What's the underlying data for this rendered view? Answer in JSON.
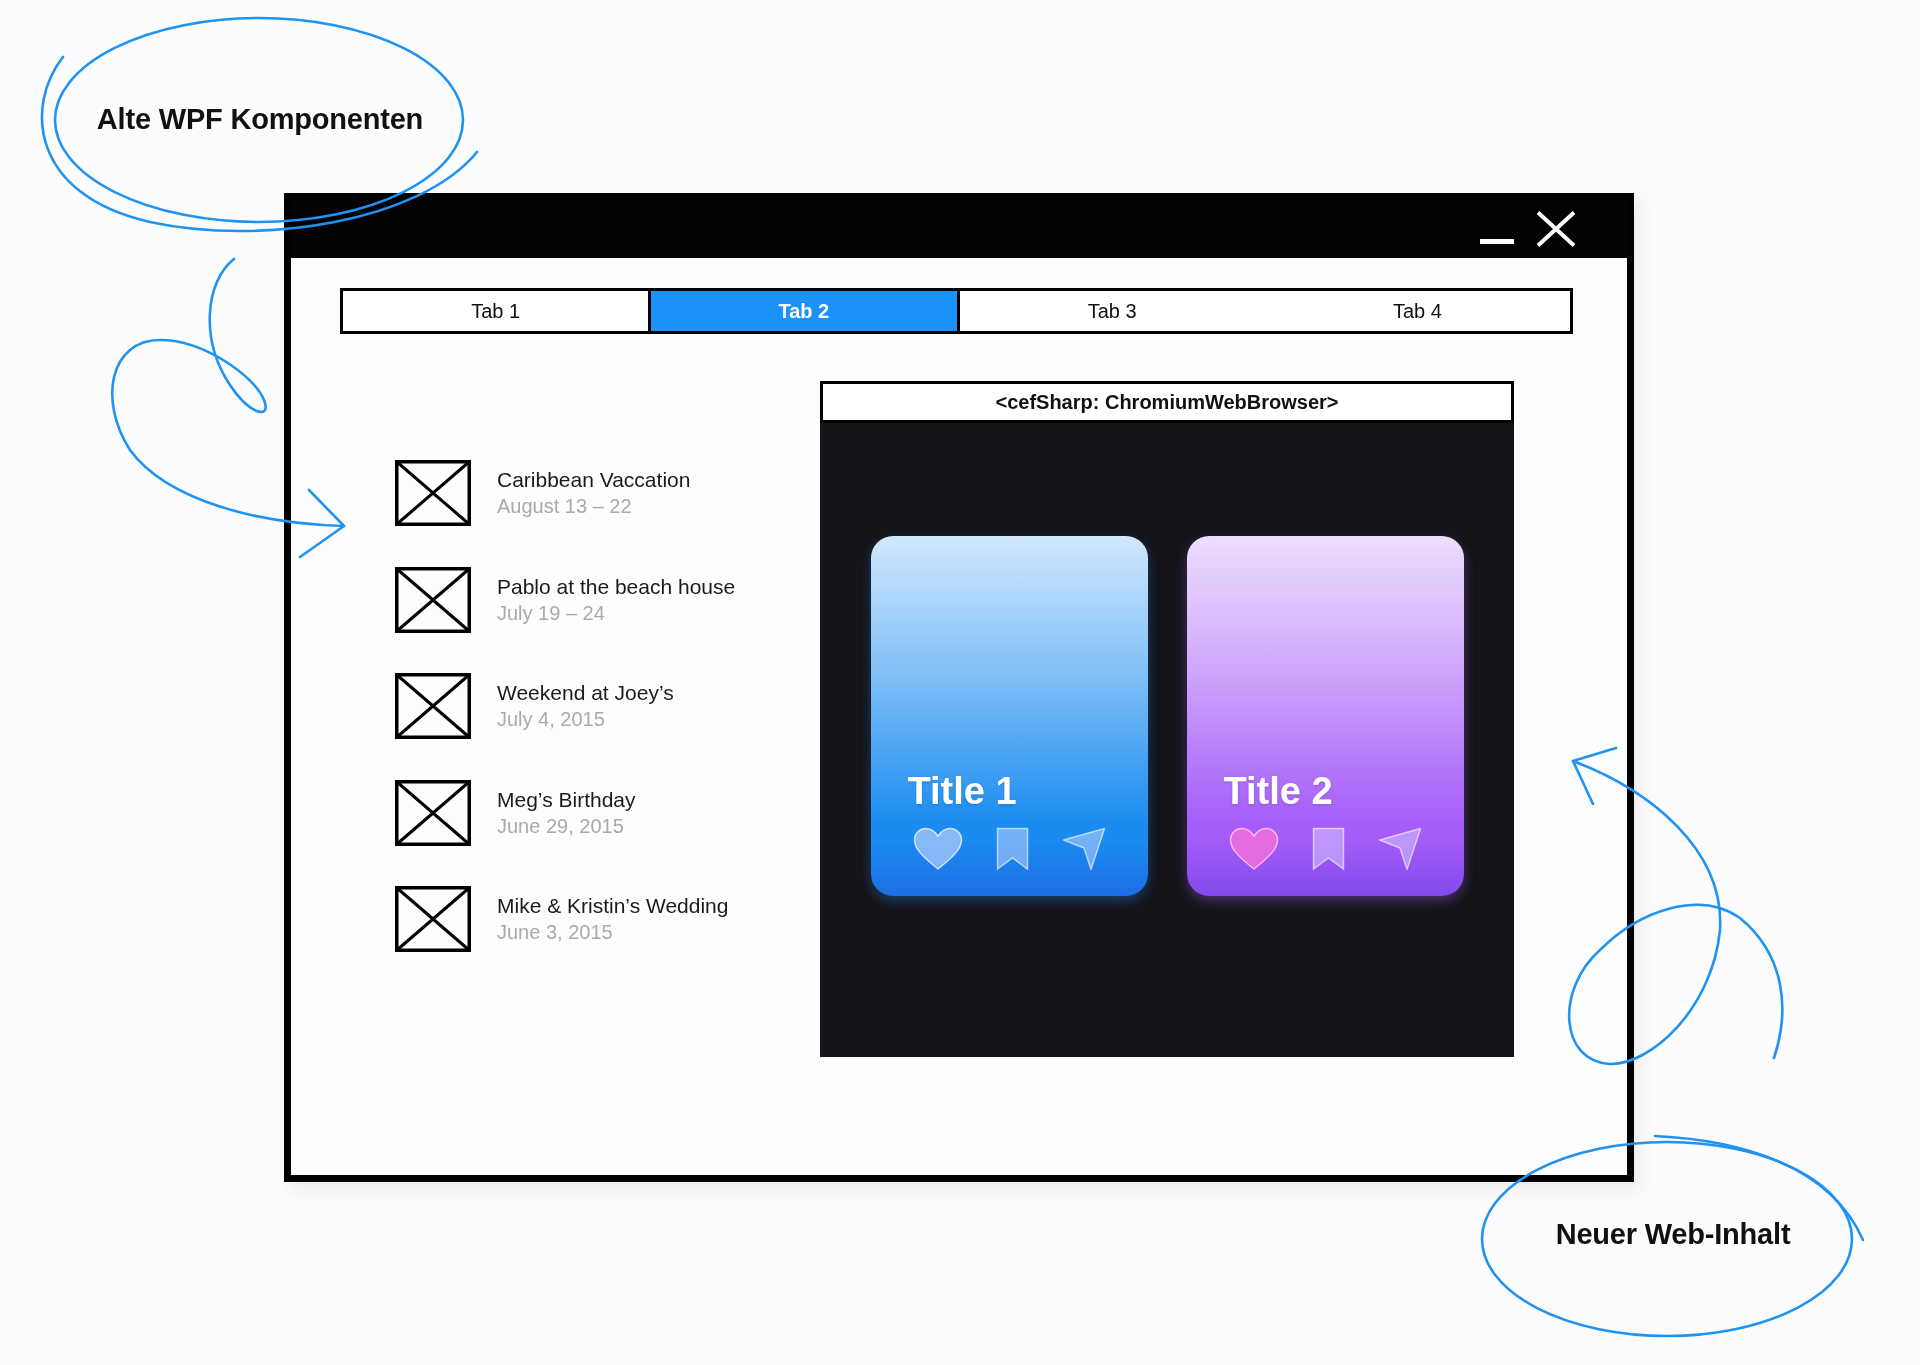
{
  "annotations": {
    "top_label": "Alte WPF Komponenten",
    "bottom_label": "Neuer Web-Inhalt"
  },
  "window": {
    "tabs": [
      {
        "label": "Tab 1",
        "selected": false
      },
      {
        "label": "Tab 2",
        "selected": true
      },
      {
        "label": "Tab 3",
        "selected": false
      },
      {
        "label": "Tab 4",
        "selected": false
      }
    ],
    "list": [
      {
        "title": "Caribbean Vaccation",
        "date": "August 13 – 22"
      },
      {
        "title": "Pablo at the beach house",
        "date": "July 19 – 24"
      },
      {
        "title": "Weekend at Joey’s",
        "date": "July 4, 2015"
      },
      {
        "title": "Meg’s Birthday",
        "date": "June 29, 2015"
      },
      {
        "title": "Mike & Kristin’s Wedding",
        "date": "June 3, 2015"
      }
    ],
    "browser": {
      "header": "<cefSharp: ChromiumWebBrowser>",
      "cards": [
        {
          "title": "Title 1",
          "color": "#1a8cf0",
          "liked": false
        },
        {
          "title": "Title 2",
          "color": "#a55cf9",
          "liked": true
        }
      ]
    }
  }
}
